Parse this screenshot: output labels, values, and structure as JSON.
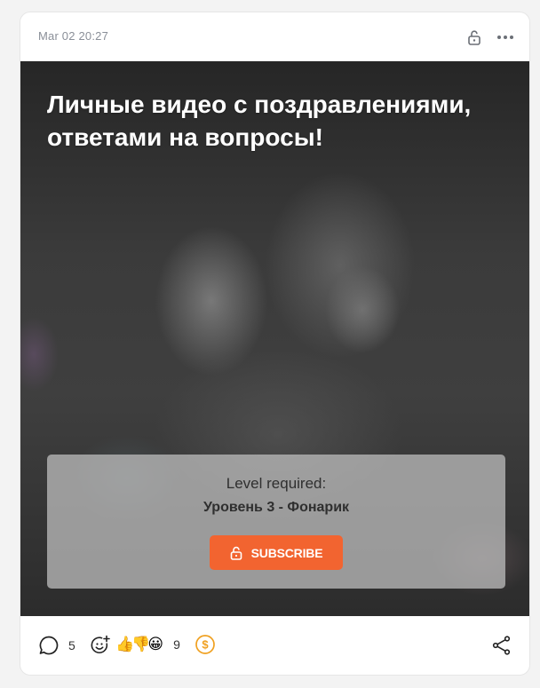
{
  "post": {
    "date": "Mar 02 20:27",
    "title": "Личные видео с поздравлениями, ответами на вопросы!",
    "lock_panel": {
      "label": "Level required:",
      "level_name": "Уровень 3 - Фонарик",
      "button_label": "SUBSCRIBE"
    },
    "footer": {
      "comments_count": "5",
      "reactions": [
        "👍",
        "👎",
        "😀"
      ],
      "reactions_count": "9"
    }
  },
  "icons": {
    "header": [
      "lock-icon",
      "more-icon"
    ],
    "footer": [
      "comment-icon",
      "add-reaction-icon",
      "donate-icon",
      "share-icon"
    ]
  },
  "colors": {
    "accent": "#f26430",
    "donate": "#f0a020",
    "text_muted": "#8a8f98"
  }
}
